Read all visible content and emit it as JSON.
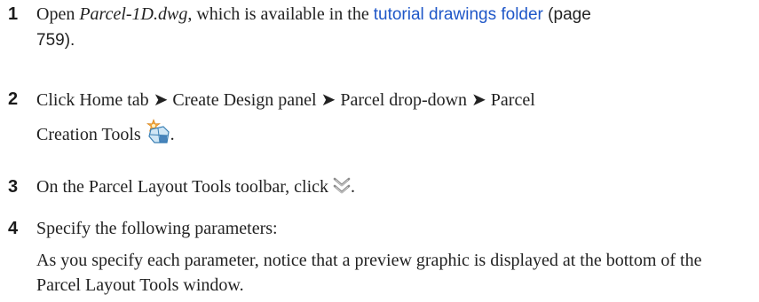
{
  "steps": [
    {
      "number": "1",
      "text_open": "Open ",
      "file_name": "Parcel-1D.dwg",
      "text_mid": ", which is available in the ",
      "link_text": "tutorial drawings folder",
      "page_ref_open": " (page",
      "page_num": "759",
      "page_ref_close": ")."
    },
    {
      "number": "2",
      "line1": "Click Home tab ➤ Create Design panel ➤ Parcel drop-down ➤ Parcel",
      "line2_text": "Creation Tools",
      "icon": "parcel-creation-tools-icon",
      "end": "."
    },
    {
      "number": "3",
      "text": "On the Parcel Layout Tools toolbar, click",
      "icon": "expand-toolbar-chevron-icon",
      "end": "."
    },
    {
      "number": "4",
      "text": "Specify the following parameters:",
      "note": "As you specify each parameter, notice that a preview graphic is displayed at the bottom of the Parcel Layout Tools window."
    }
  ]
}
